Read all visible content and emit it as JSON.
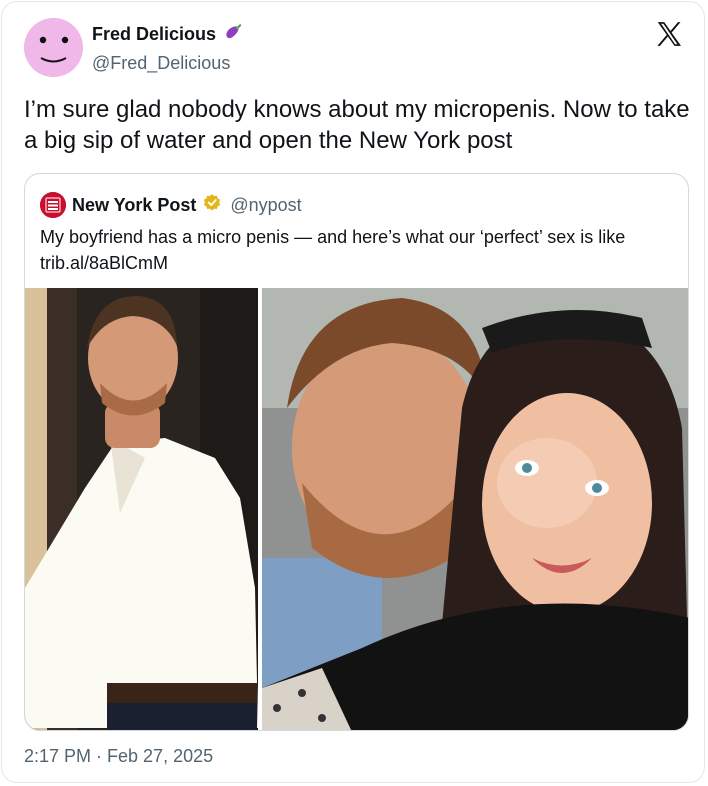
{
  "author": {
    "display_name": "Fred Delicious",
    "name_emoji": "eggplant-icon",
    "handle": "@Fred_Delicious"
  },
  "tweet": {
    "text": "I’m sure glad nobody knows about my micropenis. Now to take a big sip of water and open the New York post",
    "timestamp": "2:17 PM · Feb 27, 2025"
  },
  "quoted": {
    "name": "New York Post",
    "verified_badge": "gold-check-icon",
    "handle": "@nypost",
    "text": "My boyfriend has a micro penis — and here’s what our ‘perfect’ sex is like",
    "link": "trib.al/8aBlCmM",
    "logo_text": "NEW YORK POST"
  },
  "colors": {
    "avatar_bg": "#f0b8e8",
    "nyp_red": "#c8102e",
    "verified_gold": "#e2b719",
    "secondary_text": "#536471"
  }
}
